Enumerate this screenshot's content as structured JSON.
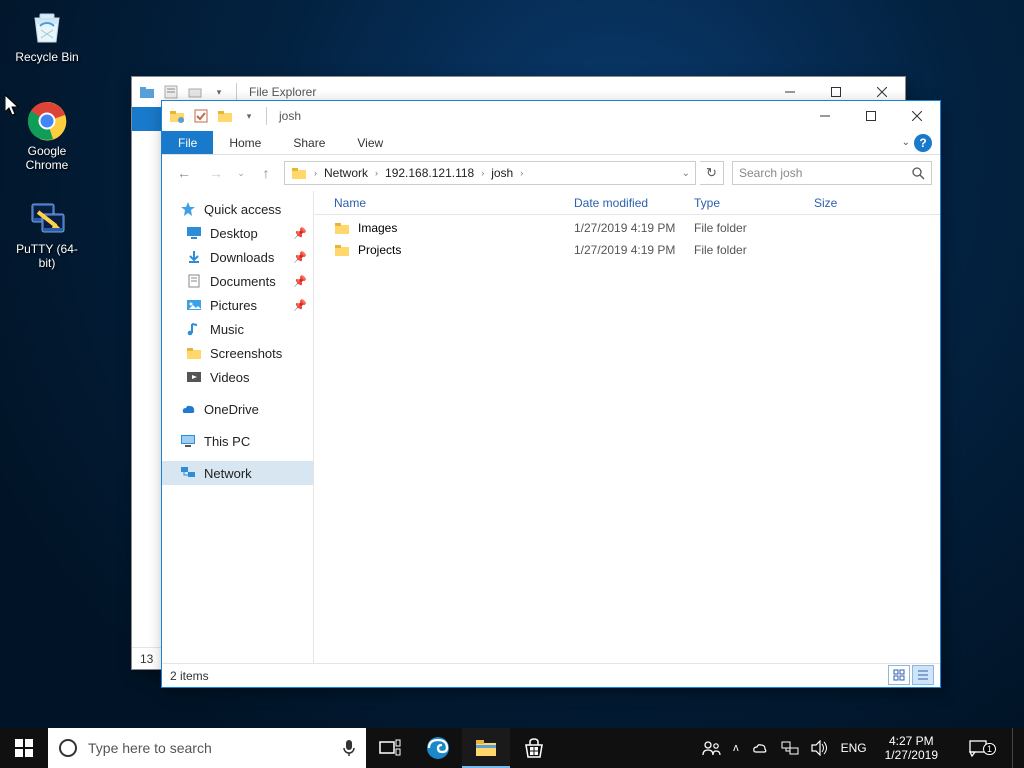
{
  "desktop": {
    "icons": [
      {
        "name": "recycle-bin",
        "label": "Recycle Bin"
      },
      {
        "name": "google-chrome",
        "label": "Google Chrome"
      },
      {
        "name": "putty",
        "label": "PuTTY (64-bit)"
      }
    ]
  },
  "back_window": {
    "title": "File Explorer",
    "status_count": "13"
  },
  "window": {
    "title": "josh",
    "ribbon": {
      "file": "File",
      "home": "Home",
      "share": "Share",
      "view": "View"
    },
    "breadcrumb": [
      "Network",
      "192.168.121.118",
      "josh"
    ],
    "search_placeholder": "Search josh",
    "columns": {
      "name": "Name",
      "modified": "Date modified",
      "type": "Type",
      "size": "Size"
    },
    "rows": [
      {
        "name": "Images",
        "modified": "1/27/2019 4:19 PM",
        "type": "File folder"
      },
      {
        "name": "Projects",
        "modified": "1/27/2019 4:19 PM",
        "type": "File folder"
      }
    ],
    "status": "2 items"
  },
  "tree": {
    "quick_access": "Quick access",
    "children": [
      "Desktop",
      "Downloads",
      "Documents",
      "Pictures",
      "Music",
      "Screenshots",
      "Videos"
    ],
    "onedrive": "OneDrive",
    "thispc": "This PC",
    "network": "Network"
  },
  "taskbar": {
    "search_placeholder": "Type here to search",
    "lang": "ENG",
    "time": "4:27 PM",
    "date": "1/27/2019",
    "notif_count": "1"
  }
}
